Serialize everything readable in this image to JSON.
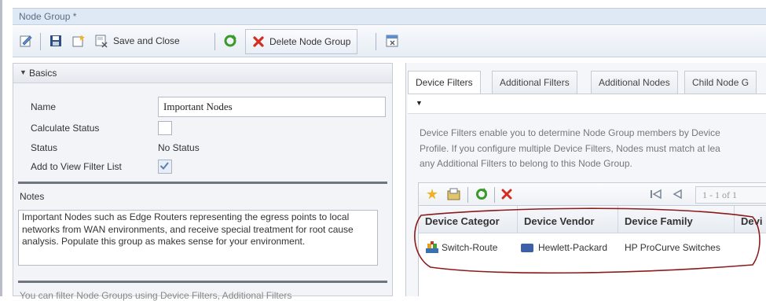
{
  "window": {
    "title": "Node Group *"
  },
  "toolbar": {
    "save_close_label": "Save and Close",
    "delete_label": "Delete Node Group"
  },
  "basics": {
    "header": "Basics",
    "name_label": "Name",
    "name_value": "Important Nodes",
    "calculate_status_label": "Calculate Status",
    "calculate_status_checked": false,
    "status_label": "Status",
    "status_value": "No Status",
    "add_to_view_label": "Add to View Filter List",
    "add_to_view_checked": true
  },
  "notes": {
    "header": "Notes",
    "text": "Important Nodes such as Edge Routers representing the egress points to local networks from WAN environments, and receive special treatment for root cause analysis.   Populate this group as makes sense for your environment."
  },
  "bottom_hint": "You can filter Node Groups using Device Filters, Additional Filters",
  "tabs": [
    "Device Filters",
    "Additional Filters",
    "Additional Nodes",
    "Child Node G"
  ],
  "device_filters": {
    "description": "Device Filters enable you to determine Node Group members by Device Profile. If you configure multiple Device Filters, Nodes must match at lea any Additional Filters to belong to this Node Group.",
    "desc_lines": [
      "Device Filters enable you to determine Node Group members by Device",
      "Profile. If you configure multiple Device Filters, Nodes must match at lea",
      "any Additional Filters to belong to this Node Group."
    ],
    "pager": "1 - 1 of 1",
    "columns": [
      "Device Categor",
      "Device Vendor",
      "Device Family",
      "Devi"
    ],
    "rows": [
      {
        "category": "Switch-Route",
        "vendor": "Hewlett-Packard",
        "family": "HP ProCurve Switches"
      }
    ]
  },
  "colors": {
    "accent_blue": "#dfe8f5",
    "delete_red": "#d62b1f",
    "refresh_green": "#3a9a2a",
    "annotation_red": "#8b1a1a"
  }
}
